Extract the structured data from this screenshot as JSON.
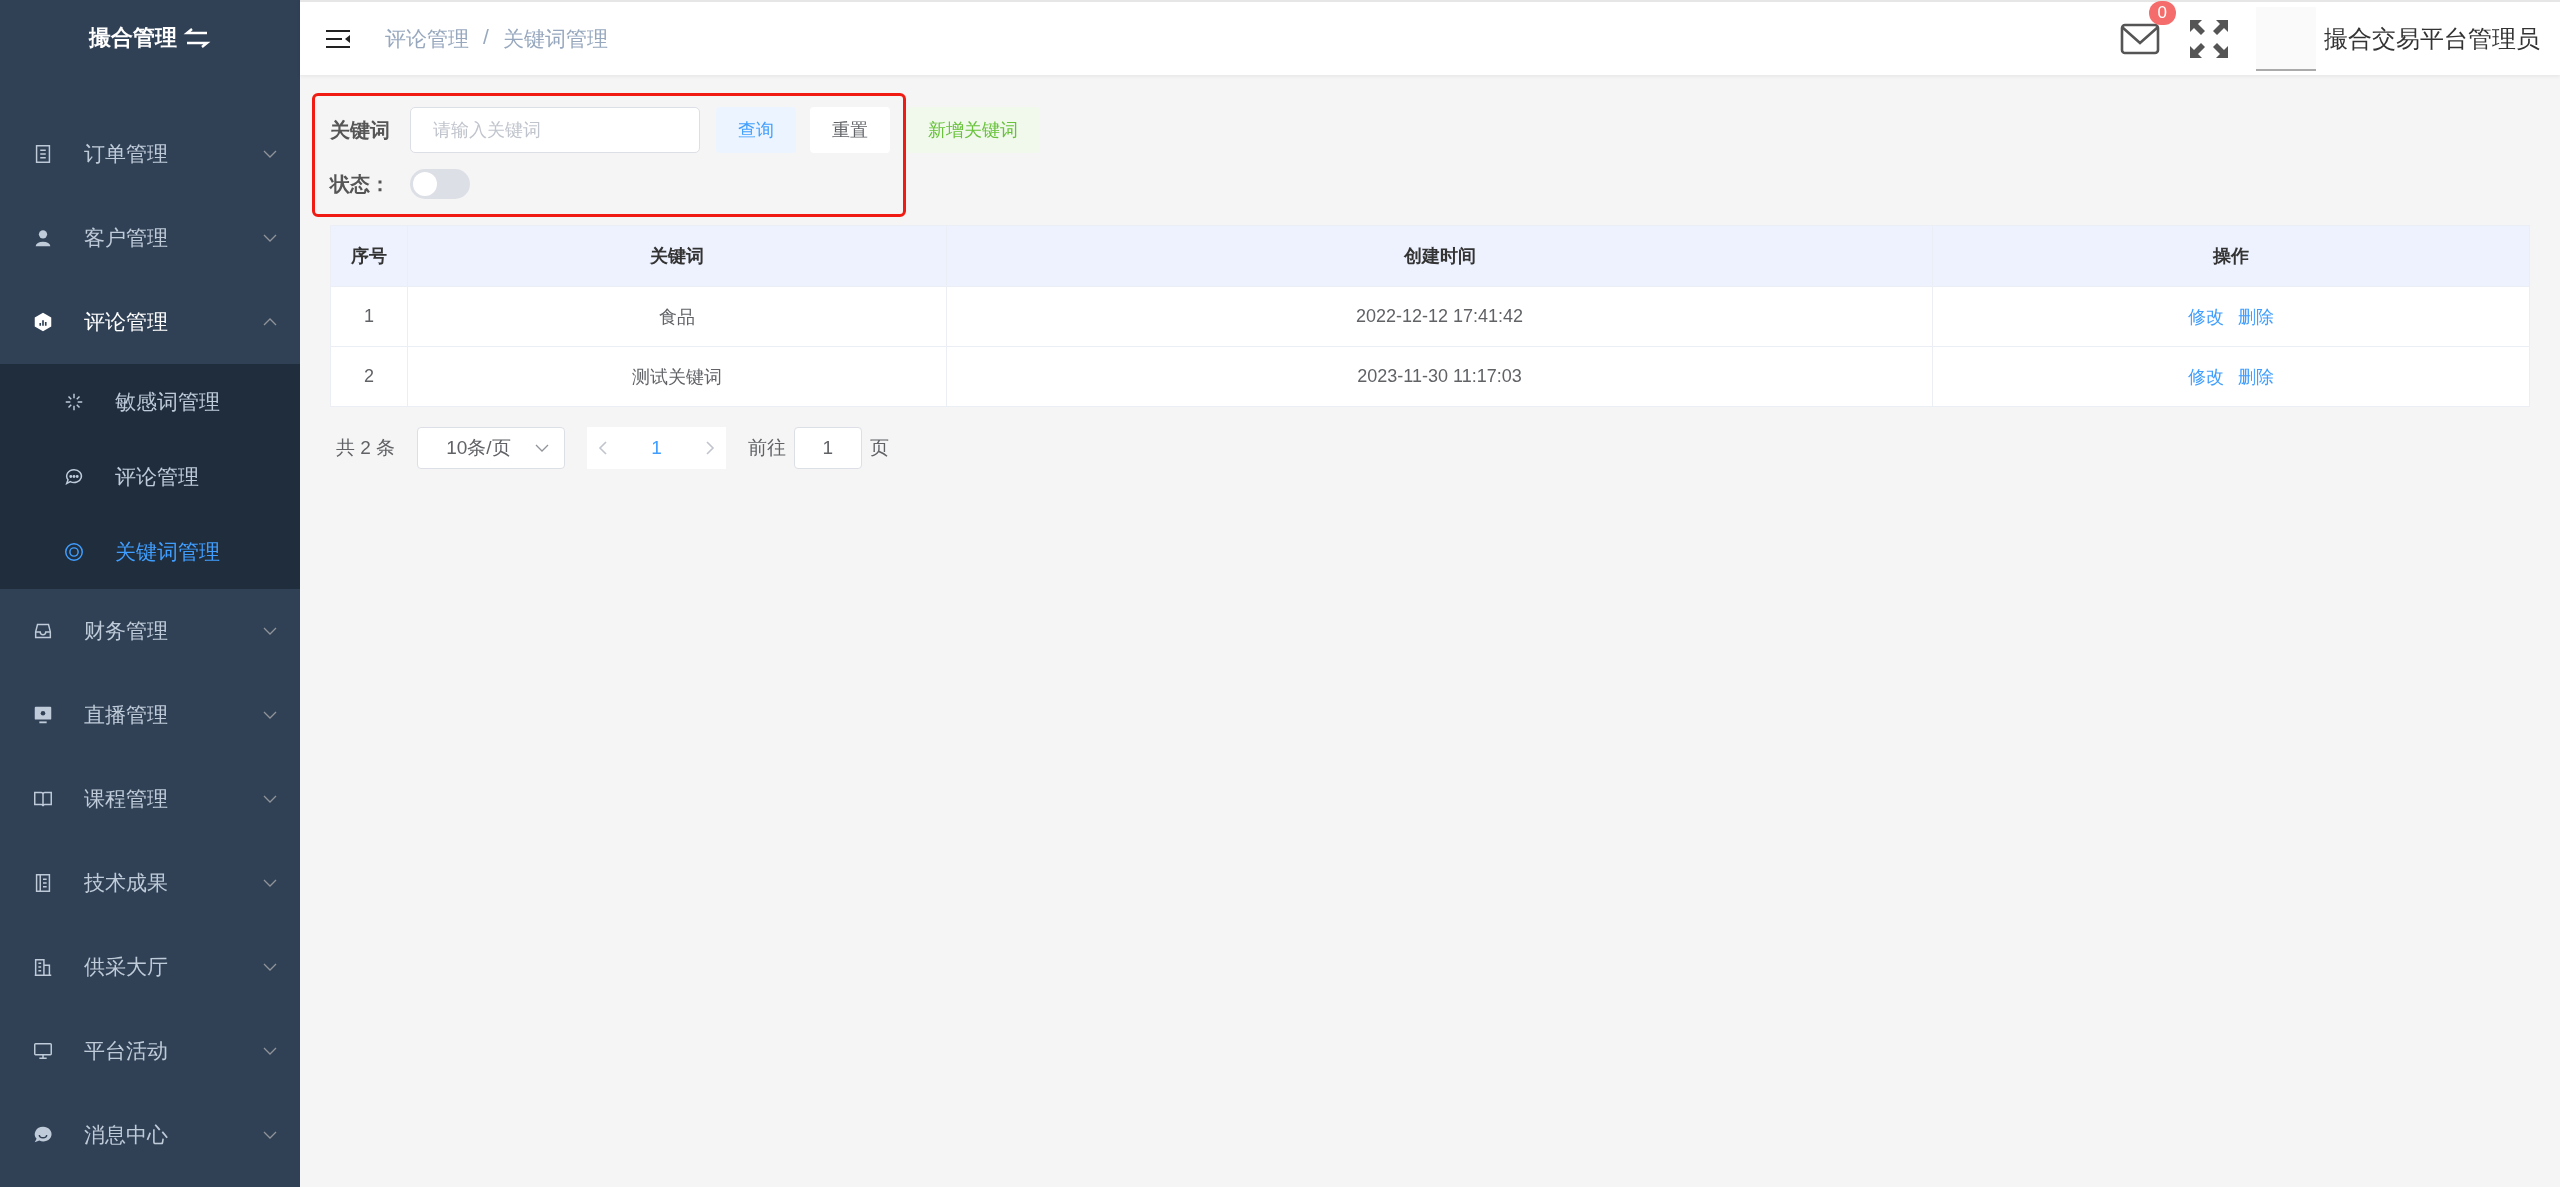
{
  "sidebar": {
    "title": "撮合管理",
    "items": [
      {
        "label": "订单管理",
        "expanded": false
      },
      {
        "label": "客户管理",
        "expanded": false
      },
      {
        "label": "评论管理",
        "expanded": true,
        "children": [
          {
            "label": "敏感词管理",
            "selected": false
          },
          {
            "label": "评论管理",
            "selected": false
          },
          {
            "label": "关键词管理",
            "selected": true
          }
        ]
      },
      {
        "label": "财务管理",
        "expanded": false
      },
      {
        "label": "直播管理",
        "expanded": false
      },
      {
        "label": "课程管理",
        "expanded": false
      },
      {
        "label": "技术成果",
        "expanded": false
      },
      {
        "label": "供采大厅",
        "expanded": false
      },
      {
        "label": "平台活动",
        "expanded": false
      },
      {
        "label": "消息中心",
        "expanded": false
      }
    ]
  },
  "header": {
    "breadcrumb": [
      "评论管理",
      "关键词管理"
    ],
    "separator": "/",
    "mail_badge": "0",
    "user_name": "撮合交易平台管理员"
  },
  "filter": {
    "keyword": {
      "label": "关键词",
      "placeholder": "请输入关键词"
    },
    "buttons": [
      {
        "label": "查询",
        "kind": "primary"
      },
      {
        "label": "重置",
        "kind": "default"
      },
      {
        "label": "新增关键词",
        "kind": "success"
      }
    ],
    "status": {
      "label": "状态：",
      "on": false
    }
  },
  "table": {
    "columns": [
      "序号",
      "关键词",
      "创建时间",
      "操作"
    ],
    "rows": [
      {
        "index": "1",
        "keyword": "食品",
        "created": "2022-12-12 17:41:42",
        "actions": [
          "修改",
          "删除"
        ]
      },
      {
        "index": "2",
        "keyword": "测试关键词",
        "created": "2023-11-30 11:17:03",
        "actions": [
          "修改",
          "删除"
        ]
      }
    ]
  },
  "pagination": {
    "total": "共 2 条",
    "page_size": "10条/页",
    "pages": [
      {
        "label": "1",
        "selected": true
      }
    ],
    "goto_label": "前往",
    "goto_value": "1",
    "goto_suffix": "页"
  }
}
